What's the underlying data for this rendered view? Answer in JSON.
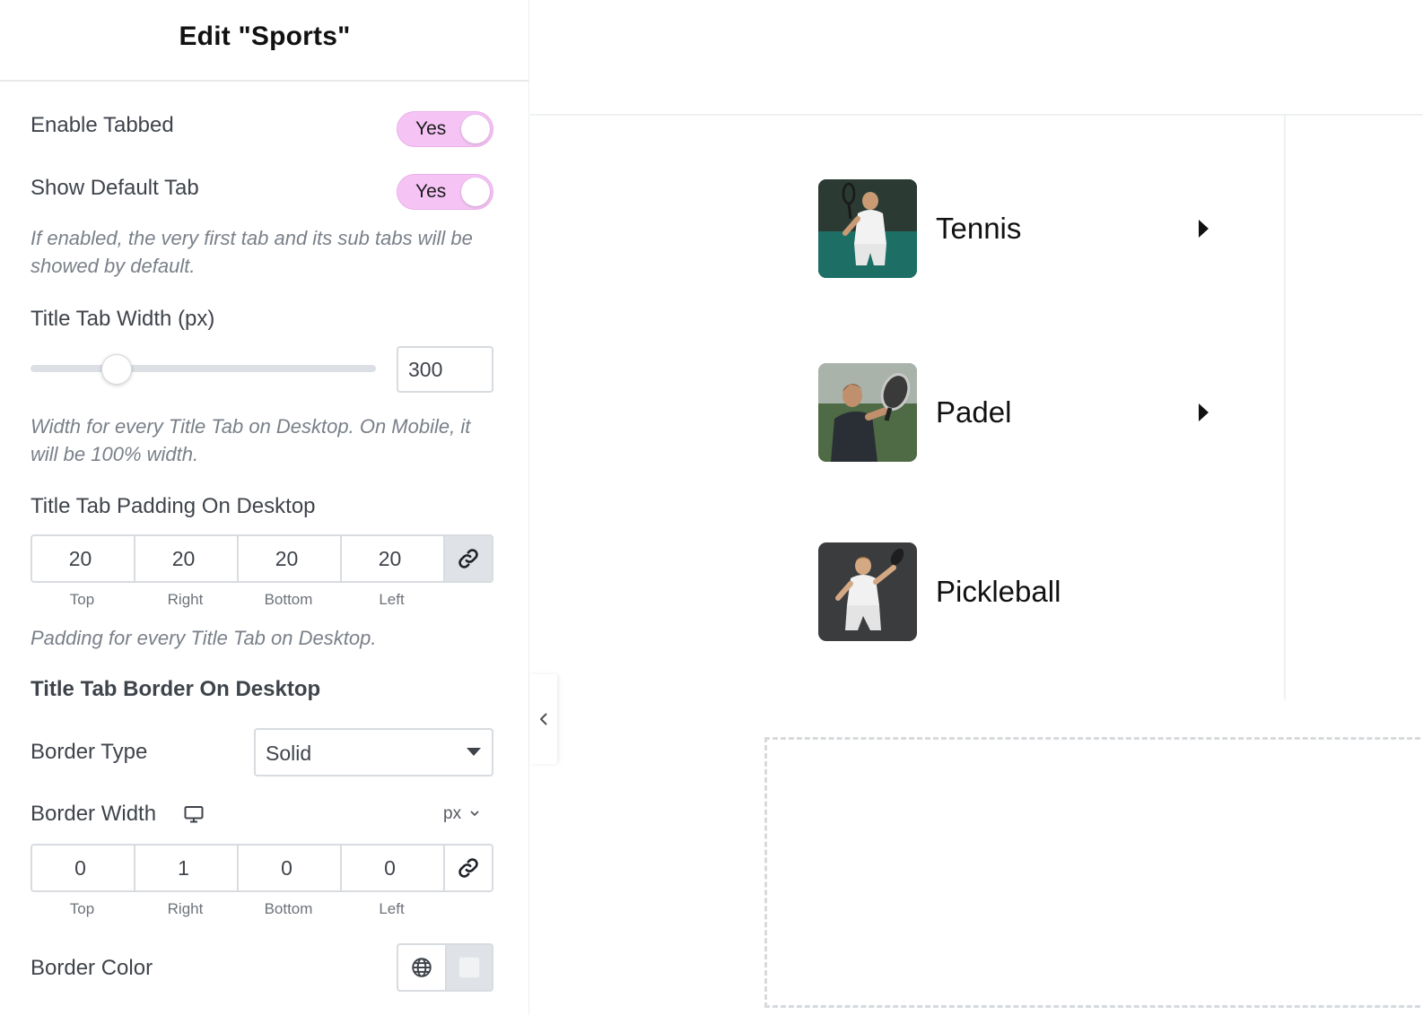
{
  "panel": {
    "title": "Edit \"Sports\"",
    "enable_tabbed": {
      "label": "Enable Tabbed",
      "value": "Yes"
    },
    "show_default_tab": {
      "label": "Show Default Tab",
      "value": "Yes"
    },
    "show_default_desc": "If enabled, the very first tab and its sub tabs will be showed by default.",
    "title_tab_width": {
      "label": "Title Tab Width (px)",
      "value": "300",
      "slider_fraction": 0.22
    },
    "title_tab_width_desc": "Width for every Title Tab on Desktop. On Mobile, it will be 100% width.",
    "padding": {
      "label": "Title Tab Padding On Desktop",
      "values": [
        "20",
        "20",
        "20",
        "20"
      ],
      "sides": [
        "Top",
        "Right",
        "Bottom",
        "Left"
      ],
      "linked": true,
      "desc": "Padding for every Title Tab on Desktop."
    },
    "border_heading": "Title Tab Border On Desktop",
    "border_type": {
      "label": "Border Type",
      "value": "Solid"
    },
    "border_width": {
      "label": "Border Width",
      "unit": "px",
      "values": [
        "0",
        "1",
        "0",
        "0"
      ],
      "sides": [
        "Top",
        "Right",
        "Bottom",
        "Left"
      ],
      "linked": false,
      "device_icon": "desktop-monitor-icon"
    },
    "border_color": {
      "label": "Border Color",
      "global_icon": "globe-icon"
    }
  },
  "preview": {
    "tabs": [
      {
        "name": "Tennis",
        "has_arrow": true
      },
      {
        "name": "Padel",
        "has_arrow": true
      },
      {
        "name": "Pickleball",
        "has_arrow": false
      }
    ]
  },
  "colors": {
    "toggle_on": "#f5c4f5",
    "text": "#3f444b",
    "muted": "#7a8089"
  }
}
